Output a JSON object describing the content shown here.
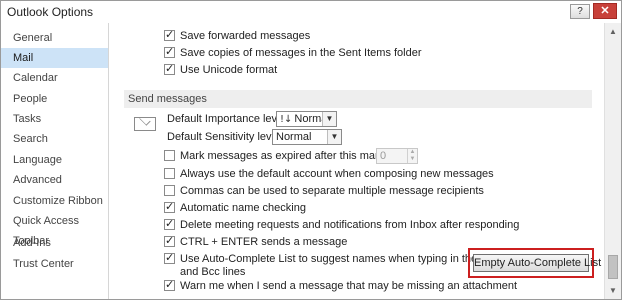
{
  "window": {
    "title": "Outlook Options",
    "help_label": "?",
    "close_label": "✕"
  },
  "sidebar": {
    "items": [
      {
        "label": "General",
        "selected": false
      },
      {
        "label": "Mail",
        "selected": true
      },
      {
        "label": "Calendar",
        "selected": false
      },
      {
        "label": "People",
        "selected": false
      },
      {
        "label": "Tasks",
        "selected": false
      },
      {
        "label": "Search",
        "selected": false
      },
      {
        "label": "Language",
        "selected": false
      },
      {
        "label": "Advanced",
        "selected": false
      },
      {
        "label": "Customize Ribbon",
        "selected": false
      },
      {
        "label": "Quick Access Toolbar",
        "selected": false
      },
      {
        "label": "Add-Ins",
        "selected": false
      },
      {
        "label": "Trust Center",
        "selected": false
      }
    ]
  },
  "top_options": [
    {
      "label": "Save forwarded messages",
      "checked": true
    },
    {
      "label": "Save copies of messages in the Sent Items folder",
      "checked": true
    },
    {
      "label": "Use Unicode format",
      "checked": true
    }
  ],
  "send_messages": {
    "header": "Send messages",
    "importance": {
      "label": "Default Importance level:",
      "value": "Normal"
    },
    "sensitivity": {
      "label": "Default Sensitivity level:",
      "value": "Normal"
    },
    "expire_days_value": "0",
    "options": [
      {
        "label": "Mark messages as expired after this many days:",
        "checked": false
      },
      {
        "label": "Always use the default account when composing new messages",
        "checked": false
      },
      {
        "label": "Commas can be used to separate multiple message recipients",
        "checked": false
      },
      {
        "label": "Automatic name checking",
        "checked": true
      },
      {
        "label": "Delete meeting requests and notifications from Inbox after responding",
        "checked": true
      },
      {
        "label": "CTRL + ENTER sends a message",
        "checked": true
      },
      {
        "label": "Use Auto-Complete List to suggest names when typing in the To, Cc,",
        "label_line2": "and Bcc lines",
        "checked": true
      },
      {
        "label": "Warn me when I send a message that may be missing an attachment",
        "checked": true
      }
    ],
    "empty_autocomplete_label": "Empty Auto-Complete List"
  },
  "icons": {
    "envelope": "envelope-icon",
    "priority": "priority-icon",
    "dropdown": "chevron-down-icon"
  },
  "colors": {
    "selected_nav": "#cde3f7",
    "highlight_border": "#cc1f1f",
    "close_button": "#c8413a"
  }
}
